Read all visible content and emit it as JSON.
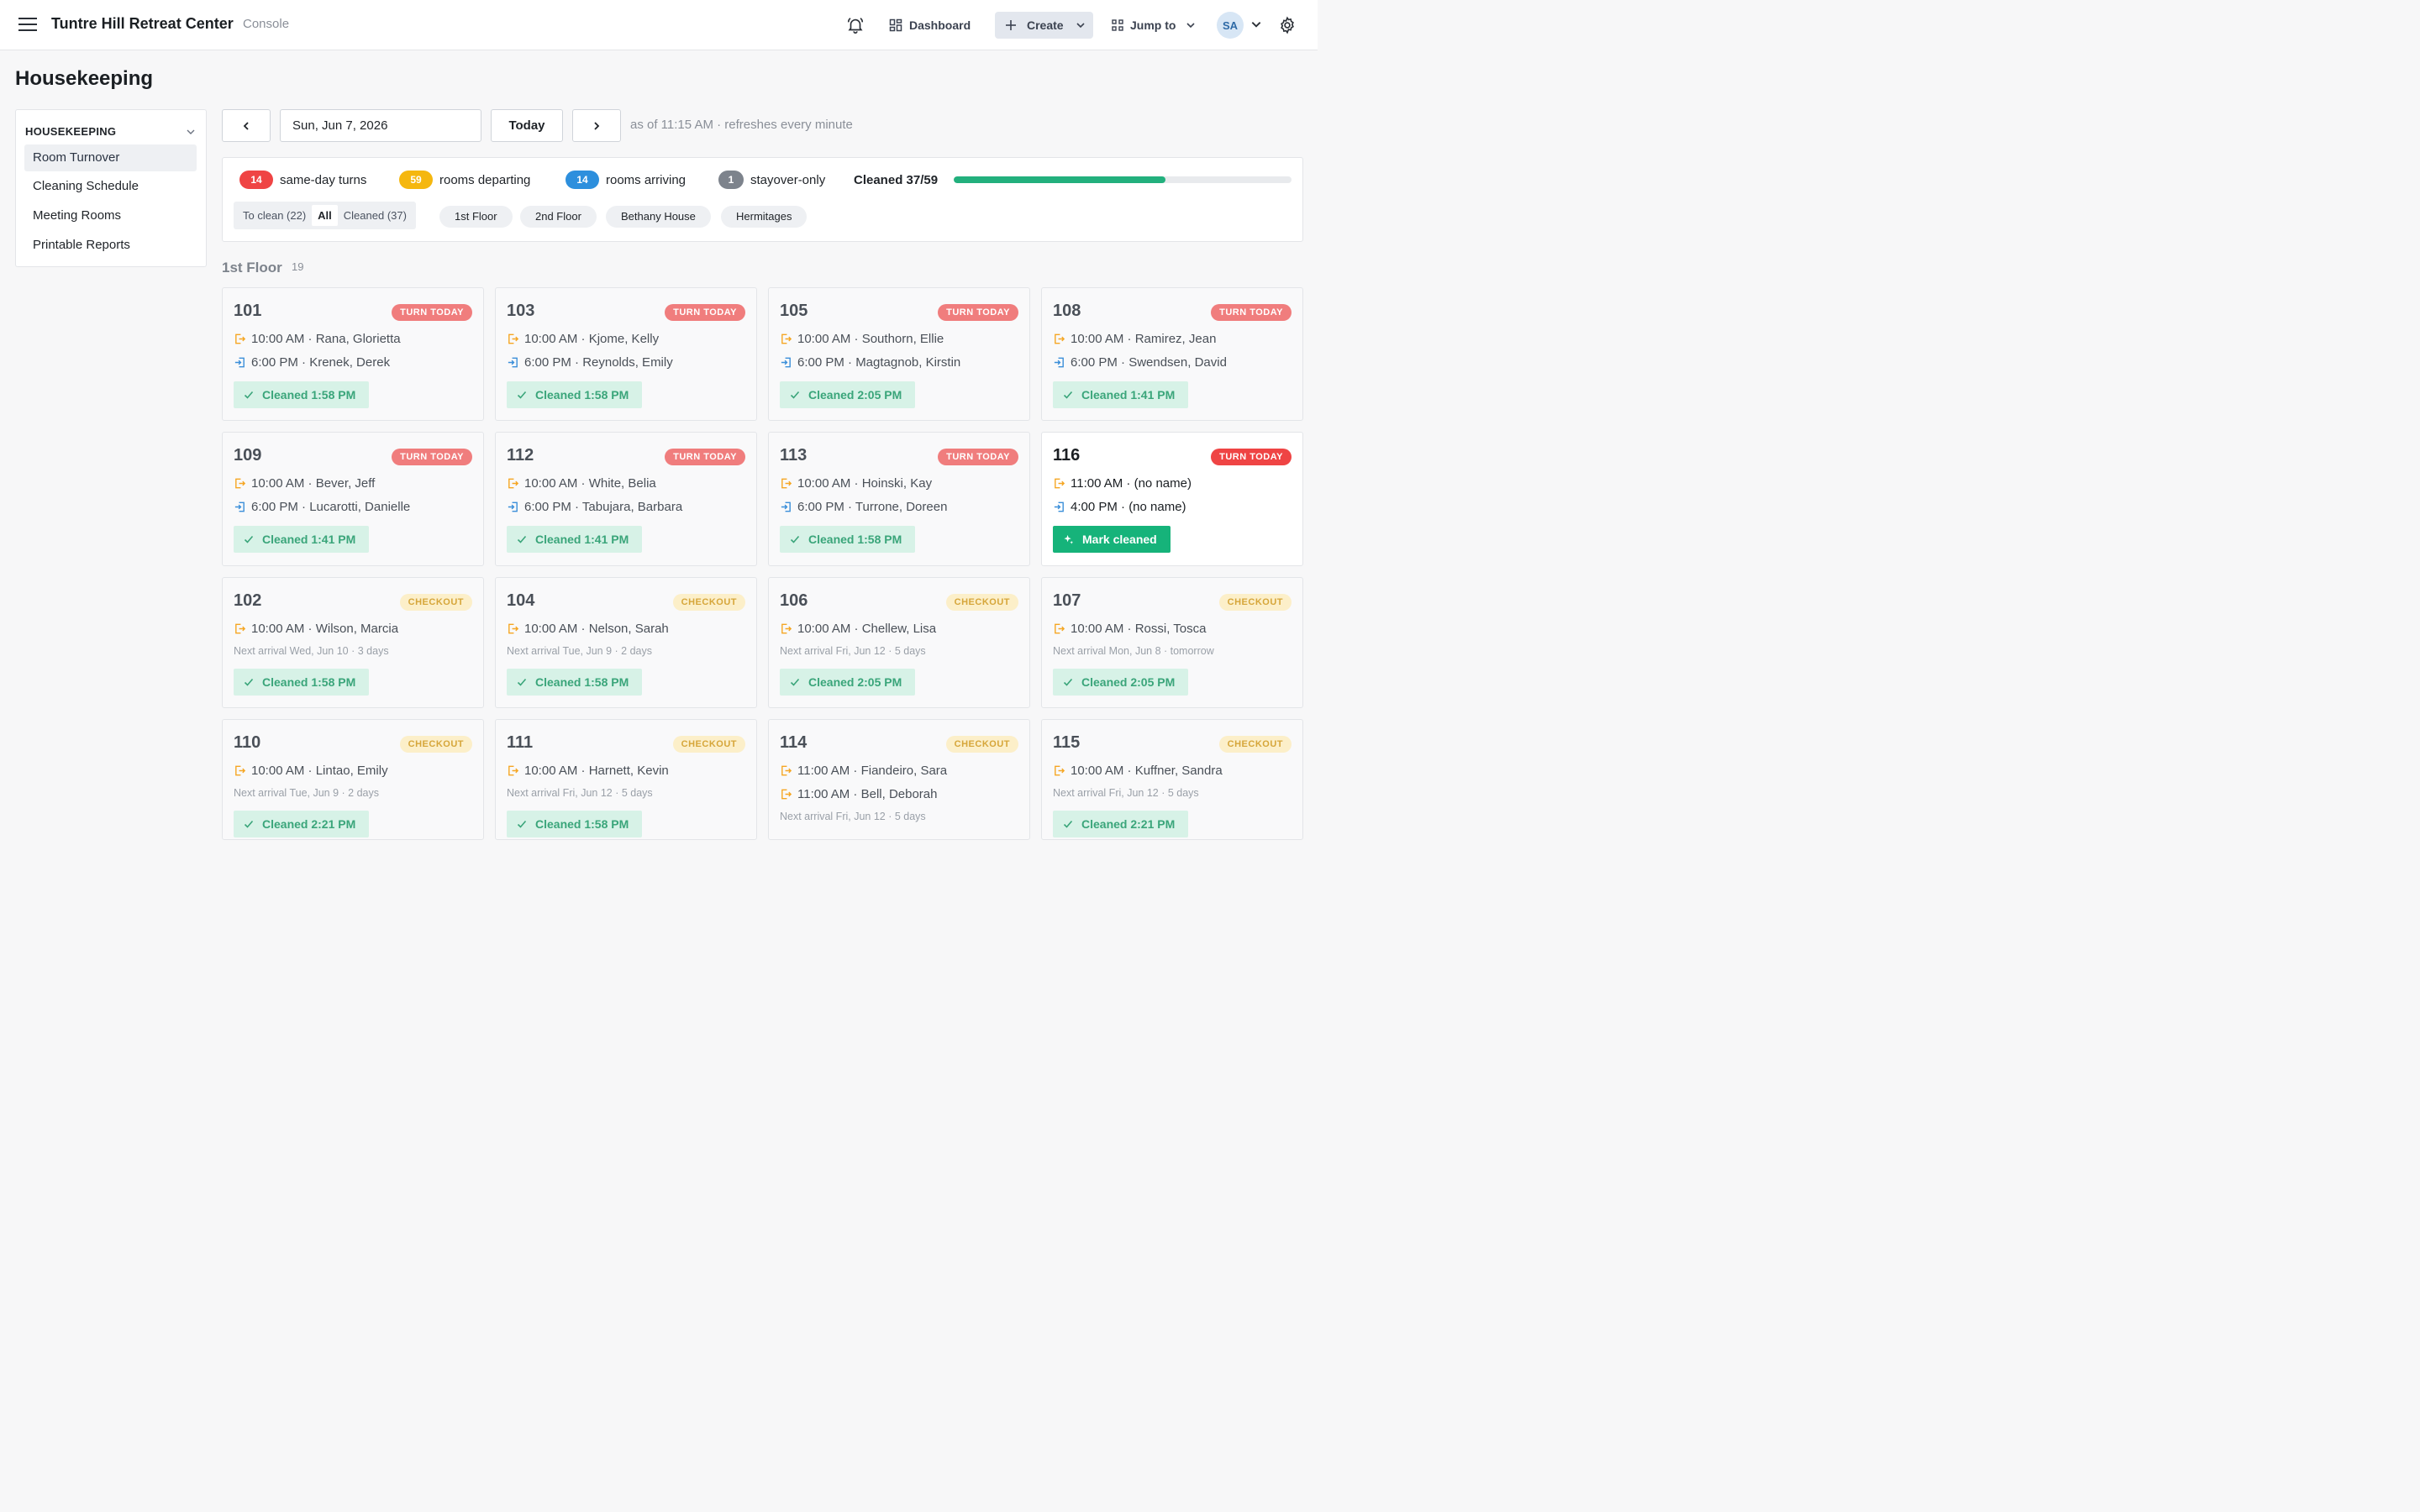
{
  "header": {
    "app_name": "Tuntre Hill Retreat Center",
    "app_sub": "Console",
    "dashboard_label": "Dashboard",
    "create_label": "Create",
    "jump_label": "Jump to",
    "avatar_initials": "SA"
  },
  "page_title": "Housekeeping",
  "sidebar": {
    "section_label": "HOUSEKEEPING",
    "items": [
      {
        "label": "Room Turnover",
        "active": true
      },
      {
        "label": "Cleaning Schedule"
      },
      {
        "label": "Meeting Rooms"
      },
      {
        "label": "Printable Reports"
      }
    ]
  },
  "date_nav": {
    "date_value": "Sun, Jun 7, 2026",
    "today_label": "Today",
    "as_of": "as of 11:15 AM · refreshes every minute"
  },
  "summary": {
    "stats": [
      {
        "count": "14",
        "label": "same-day turns",
        "color": "#ef4444"
      },
      {
        "count": "59",
        "label": "rooms departing",
        "color": "#f5b70f"
      },
      {
        "count": "14",
        "label": "rooms arriving",
        "color": "#2d8fdd"
      },
      {
        "count": "1",
        "label": "stayover-only",
        "color": "#7d838c"
      }
    ],
    "cleaned_label": "Cleaned 37/59",
    "cleaned_fraction": 0.627,
    "filter_options": [
      "To clean (22)",
      "All",
      "Cleaned (37)"
    ],
    "filter_selected": "All",
    "areas": [
      "1st Floor",
      "2nd Floor",
      "Bethany House",
      "Hermitages"
    ]
  },
  "section": {
    "title": "1st Floor",
    "count": "19"
  },
  "rooms": [
    {
      "room": "101",
      "badge": "TURN TODAY",
      "out": "10:00 AM · Rana, Glorietta",
      "in": "6:00 PM · Krenek, Derek",
      "cleaned": "Cleaned 1:58 PM"
    },
    {
      "room": "103",
      "badge": "TURN TODAY",
      "out": "10:00 AM · Kjome, Kelly",
      "in": "6:00 PM · Reynolds, Emily",
      "cleaned": "Cleaned 1:58 PM"
    },
    {
      "room": "105",
      "badge": "TURN TODAY",
      "out": "10:00 AM · Southorn, Ellie",
      "in": "6:00 PM · Magtagnob, Kirstin",
      "cleaned": "Cleaned 2:05 PM"
    },
    {
      "room": "108",
      "badge": "TURN TODAY",
      "out": "10:00 AM · Ramirez, Jean",
      "in": "6:00 PM · Swendsen, David",
      "cleaned": "Cleaned 1:41 PM"
    },
    {
      "room": "109",
      "badge": "TURN TODAY",
      "out": "10:00 AM · Bever, Jeff",
      "in": "6:00 PM · Lucarotti, Danielle",
      "cleaned": "Cleaned 1:41 PM"
    },
    {
      "room": "112",
      "badge": "TURN TODAY",
      "out": "10:00 AM · White, Belia",
      "in": "6:00 PM · Tabujara, Barbara",
      "cleaned": "Cleaned 1:41 PM"
    },
    {
      "room": "113",
      "badge": "TURN TODAY",
      "out": "10:00 AM · Hoinski, Kay",
      "in": "6:00 PM · Turrone, Doreen",
      "cleaned": "Cleaned 1:58 PM"
    },
    {
      "room": "116",
      "badge": "TURN TODAY",
      "out": "11:00 AM · (no name)",
      "in": "4:00 PM · (no name)",
      "action": "Mark cleaned"
    },
    {
      "room": "102",
      "badge": "CHECKOUT",
      "out": "10:00 AM · Wilson, Marcia",
      "next": "Next arrival Wed, Jun 10 · 3 days",
      "cleaned": "Cleaned 1:58 PM"
    },
    {
      "room": "104",
      "badge": "CHECKOUT",
      "out": "10:00 AM · Nelson, Sarah",
      "next": "Next arrival Tue, Jun 9 · 2 days",
      "cleaned": "Cleaned 1:58 PM"
    },
    {
      "room": "106",
      "badge": "CHECKOUT",
      "out": "10:00 AM · Chellew, Lisa",
      "next": "Next arrival Fri, Jun 12 · 5 days",
      "cleaned": "Cleaned 2:05 PM"
    },
    {
      "room": "107",
      "badge": "CHECKOUT",
      "out": "10:00 AM · Rossi, Tosca",
      "next": "Next arrival Mon, Jun 8 · tomorrow",
      "cleaned": "Cleaned 2:05 PM"
    },
    {
      "room": "110",
      "badge": "CHECKOUT",
      "out": "10:00 AM · Lintao, Emily",
      "next": "Next arrival Tue, Jun 9 · 2 days",
      "cleaned": "Cleaned 2:21 PM"
    },
    {
      "room": "111",
      "badge": "CHECKOUT",
      "out": "10:00 AM · Harnett, Kevin",
      "next": "Next arrival Fri, Jun 12 · 5 days",
      "cleaned": "Cleaned 1:58 PM"
    },
    {
      "room": "114",
      "badge": "CHECKOUT",
      "out": "11:00 AM · Fiandeiro, Sara",
      "out2": "11:00 AM · Bell, Deborah",
      "next": "Next arrival Fri, Jun 12 · 5 days"
    },
    {
      "room": "115",
      "badge": "CHECKOUT",
      "out": "10:00 AM · Kuffner, Sandra",
      "next": "Next arrival Fri, Jun 12 · 5 days",
      "cleaned": "Cleaned 2:21 PM"
    }
  ],
  "icons": {
    "menu": "hamburger-icon",
    "bell": "bell-icon",
    "dashboard": "grid-icon",
    "create": "plus-icon",
    "jump": "apps-icon",
    "settings": "gear-icon",
    "departure": "exit-arrow-icon",
    "arrival": "enter-arrow-icon",
    "cleaned": "check-icon",
    "mark": "sparkle-icon"
  },
  "colors": {
    "turn_badge": "#f07d7d",
    "checkout_badge_bg": "#fcefc9",
    "checkout_badge_text": "#d6a63a",
    "cleaned_bg": "#d7f2e7",
    "cleaned_text": "#3aa57a",
    "mark_btn": "#16b37a",
    "progress": "#22b07d",
    "departure_icon": "#f5a623",
    "arrival_icon": "#3b8fd9"
  }
}
